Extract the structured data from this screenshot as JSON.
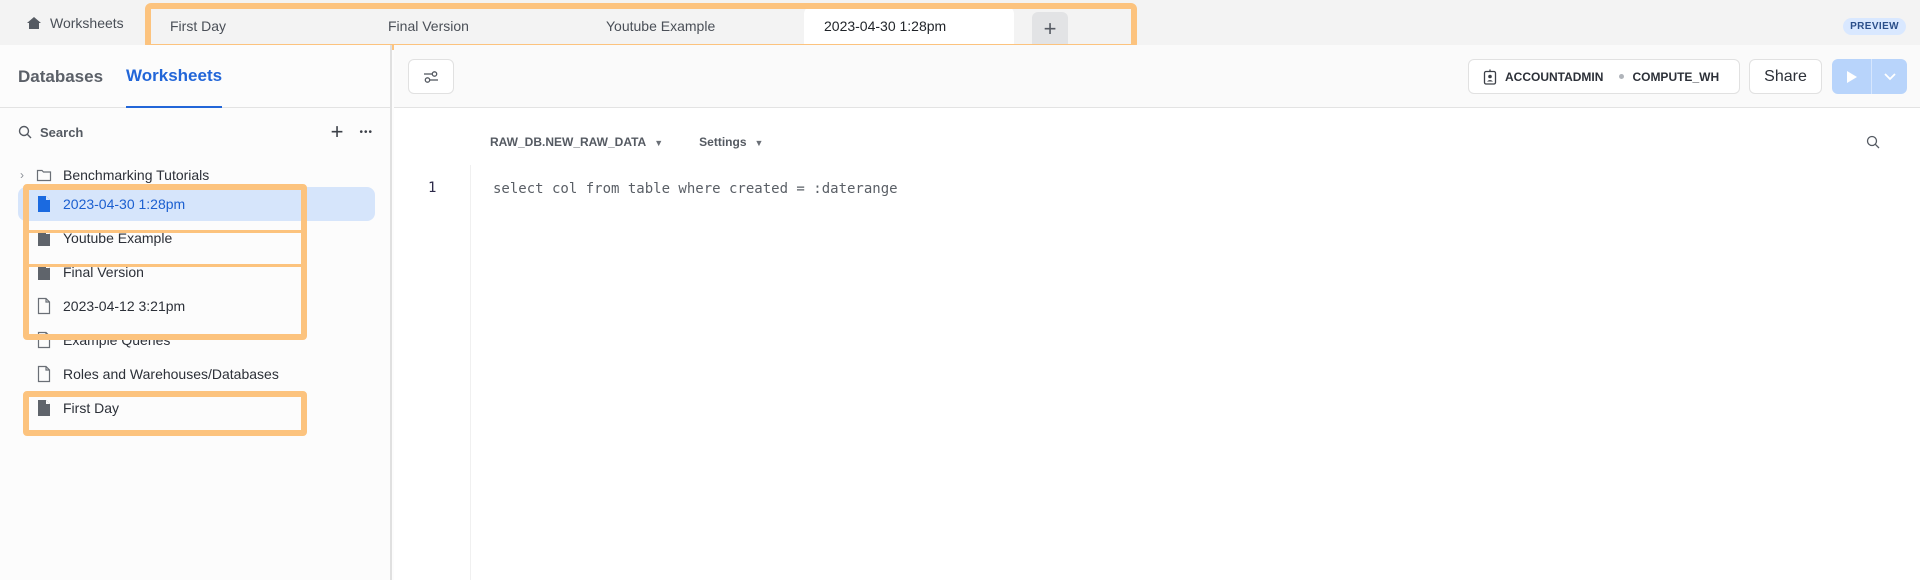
{
  "topbar": {
    "home_label": "Worksheets",
    "home_icon": "home-icon",
    "tabs": [
      {
        "label": "First Day",
        "active": false
      },
      {
        "label": "Final Version",
        "active": false
      },
      {
        "label": "Youtube Example",
        "active": false
      },
      {
        "label": "2023-04-30 1:28pm",
        "active": true
      }
    ],
    "add_tab_icon": "plus-icon",
    "add_tab_glyph": "+",
    "preview_badge": "PREVIEW"
  },
  "sidebar": {
    "tabs": [
      {
        "label": "Databases",
        "active": false
      },
      {
        "label": "Worksheets",
        "active": true
      }
    ],
    "search_label": "Search",
    "add_glyph": "+",
    "more_glyph": "•••",
    "tree": [
      {
        "type": "folder",
        "label": "Benchmarking Tutorials",
        "collapsed": true
      },
      {
        "type": "worksheet",
        "label": "2023-04-30 1:28pm",
        "selected": true,
        "open": true
      },
      {
        "type": "worksheet",
        "label": "Youtube Example",
        "selected": false,
        "open": true
      },
      {
        "type": "worksheet",
        "label": "Final Version",
        "selected": false,
        "open": true
      },
      {
        "type": "worksheet",
        "label": "2023-04-12 3:21pm",
        "selected": false,
        "open": false
      },
      {
        "type": "worksheet",
        "label": "Example Queries",
        "selected": false,
        "open": false
      },
      {
        "type": "worksheet",
        "label": "Roles and Warehouses/Databases",
        "selected": false,
        "open": false
      },
      {
        "type": "worksheet",
        "label": "First Day",
        "selected": false,
        "open": true
      }
    ]
  },
  "toolbar": {
    "role": "ACCOUNTADMIN",
    "warehouse": "COMPUTE_WH",
    "share_label": "Share",
    "run_icon": "play-icon",
    "run_more_icon": "chevron-down-icon"
  },
  "editor": {
    "context_label": "RAW_DB.NEW_RAW_DATA",
    "settings_label": "Settings",
    "caret_glyph": "▼",
    "line_number": "1",
    "code": "select col from table where created = :daterange"
  },
  "colors": {
    "accent": "#2266d8",
    "selected_bg": "#d6e5fb",
    "highlight": "#fcc37e",
    "run_button": "#b8d4fb"
  }
}
